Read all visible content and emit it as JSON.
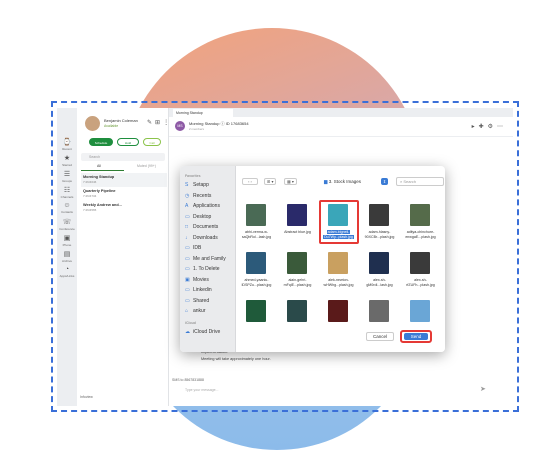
{
  "profile": {
    "name": "Benjamin Coleman",
    "status": "Available"
  },
  "rail": [
    "Recent",
    "Starred",
    "Groups",
    "Channels",
    "Contacts",
    "Conference",
    "Phone",
    "Archive",
    "Apps/Links"
  ],
  "status_pills": [
    {
      "label": "Schedule",
      "color": "#1e8e3e"
    },
    {
      "label": "Hold",
      "color": "#1e8e3e"
    },
    {
      "label": "Call",
      "color": "#8bc34a"
    }
  ],
  "list": {
    "search_placeholder": "Search",
    "tabs": [
      "All",
      "Muted (99+)"
    ],
    "conversations": [
      {
        "title": "Morning Standup",
        "sub": "7:26/4646"
      },
      {
        "title": "Quarterly Pipeline",
        "sub": "7:26/4734"
      },
      {
        "title": "Weekly Andrew and...",
        "sub": "7:26/4565"
      }
    ]
  },
  "chat": {
    "tab": "Morning Standup",
    "avatar": "MS",
    "title": "Morning Standup ⓘ  ID 17683654",
    "subtitle": "2 members",
    "message_1": "Implementation.",
    "message_2": "Meeting will take approximately one hour.",
    "sms": "SMS to 8567831888",
    "composer_placeholder": "Type your message...",
    "footer_user": "Infoview"
  },
  "dialog": {
    "sidebar_sections": [
      {
        "heading": "Favorites",
        "items": [
          {
            "label": "Setapp",
            "icon": "S"
          },
          {
            "label": "Recents",
            "icon": "◷"
          },
          {
            "label": "Applications",
            "icon": "A"
          },
          {
            "label": "Desktop",
            "icon": "▭"
          },
          {
            "label": "Documents",
            "icon": "□"
          },
          {
            "label": "Downloads",
            "icon": "↓"
          },
          {
            "label": "IDB",
            "icon": "▭"
          },
          {
            "label": "Me and Family",
            "icon": "▭"
          },
          {
            "label": "1. To Delete",
            "icon": "▭"
          },
          {
            "label": "Movies",
            "icon": "▣"
          },
          {
            "label": "Linkedin",
            "icon": "▭"
          },
          {
            "label": "Shared",
            "icon": "▭"
          },
          {
            "label": "ankur",
            "icon": "⌂"
          }
        ]
      },
      {
        "heading": "iCloud",
        "items": [
          {
            "label": "iCloud Drive",
            "icon": "☁"
          }
        ]
      }
    ],
    "folder": "3. Stock Images",
    "search_placeholder": "Search",
    "files": [
      {
        "caption_1": "abhi-verma-w-",
        "caption_2": "saQbRol...lash.jpg",
        "color": "#4a6a55",
        "selected": false
      },
      {
        "caption_1": "Abstract blue.jpg",
        "caption_2": "",
        "color": "#2a2a6a",
        "selected": false
      },
      {
        "caption_1": "adam-bignell-",
        "caption_2": "Du7Wy...plash.jpg",
        "color": "#3aa6b9",
        "selected": true
      },
      {
        "caption_1": "adam-hlasny-",
        "caption_2": "90XCBr...plash.jpg",
        "color": "#3a3a3a",
        "selected": false
      },
      {
        "caption_1": "aditya-chinchure-",
        "caption_2": "enwgaE...plash.jpg",
        "color": "#556b4a",
        "selected": false
      },
      {
        "caption_1": "ahmed-yaaniu-",
        "caption_2": "lDSPZu...plash.jpg",
        "color": "#2c5a7a",
        "selected": false
      },
      {
        "caption_1": "alain-gehri-",
        "caption_2": "mFqiE...plash.jpg",
        "color": "#3a5a3a",
        "selected": false
      },
      {
        "caption_1": "alek-newton-",
        "caption_2": "wHWhg...plash.jpg",
        "color": "#c9a060",
        "selected": false
      },
      {
        "caption_1": "alex-sh-",
        "caption_2": "gM0rdl...lash.jpg",
        "color": "#1f2f4f",
        "selected": false
      },
      {
        "caption_1": "alex-sh-",
        "caption_2": "rfZUFh...plash.jpg",
        "color": "#3a3a3a",
        "selected": false
      },
      {
        "caption_1": "",
        "caption_2": "",
        "color": "#1f5a3a",
        "selected": false
      },
      {
        "caption_1": "",
        "caption_2": "",
        "color": "#2a4a4a",
        "selected": false
      },
      {
        "caption_1": "",
        "caption_2": "",
        "color": "#5a1a1a",
        "selected": false
      },
      {
        "caption_1": "",
        "caption_2": "",
        "color": "#6a6a6a",
        "selected": false
      },
      {
        "caption_1": "",
        "caption_2": "",
        "color": "#6aa6d6",
        "selected": false
      }
    ],
    "cancel_label": "Cancel",
    "send_label": "Send"
  }
}
